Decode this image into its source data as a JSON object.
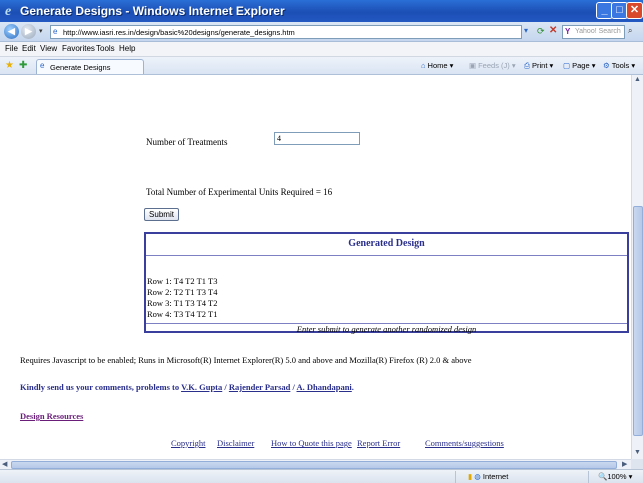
{
  "window": {
    "title": "Generate Designs - Windows Internet Explorer",
    "minimize_icon": "_",
    "maximize_icon": "□",
    "close_icon": "✕"
  },
  "address_bar": {
    "url": "http://www.iasri.res.in/design/basic%20designs/generate_designs.htm",
    "search_placeholder": "Yahoo! Search"
  },
  "menu": [
    "File",
    "Edit",
    "View",
    "Favorites",
    "Tools",
    "Help"
  ],
  "tab": {
    "label": "Generate Designs"
  },
  "commands": {
    "home": "Home",
    "feeds": "Feeds (J)",
    "print": "Print",
    "page": "Page",
    "tools": "Tools"
  },
  "form": {
    "treatments_label": "Number of Treatments",
    "treatments_value": "4",
    "total_units": "Total Number of Experimental Units Required = 16",
    "submit_label": "Submit"
  },
  "design": {
    "header": "Generated Design",
    "rows": [
      "Row 1: T4 T2 T1 T3",
      "Row 2: T2 T1 T3 T4",
      "Row 3: T1 T3 T4 T2",
      "Row 4: T3 T4 T2 T1"
    ],
    "footer": "Enter submit to generate another randomized design"
  },
  "notes": {
    "requires": "Requires Javascript to be enabled; Runs in Microsoft(R) Internet Explorer(R) 5.0 and above and Mozilla(R) Firefox (R) 2.0 & above",
    "feedback_prefix": "Kindly send us your comments, problems to",
    "contacts": [
      "V.K. Gupta",
      "Rajender Parsad",
      "A. Dhandapani"
    ],
    "separator": "/",
    "trailing": "."
  },
  "links": {
    "design_resources": "Design Resources",
    "footer": [
      "Copyright",
      "Disclaimer",
      "How to Quote this page",
      "Report Error",
      "Comments/suggestions"
    ]
  },
  "status": {
    "zone": "Internet",
    "zoom": "100%"
  },
  "colors": {
    "titlebar": "#1c4fb5",
    "design_border": "#3a3f9e",
    "link": "#2a2f8c",
    "resources_link": "#6a1e7a"
  }
}
